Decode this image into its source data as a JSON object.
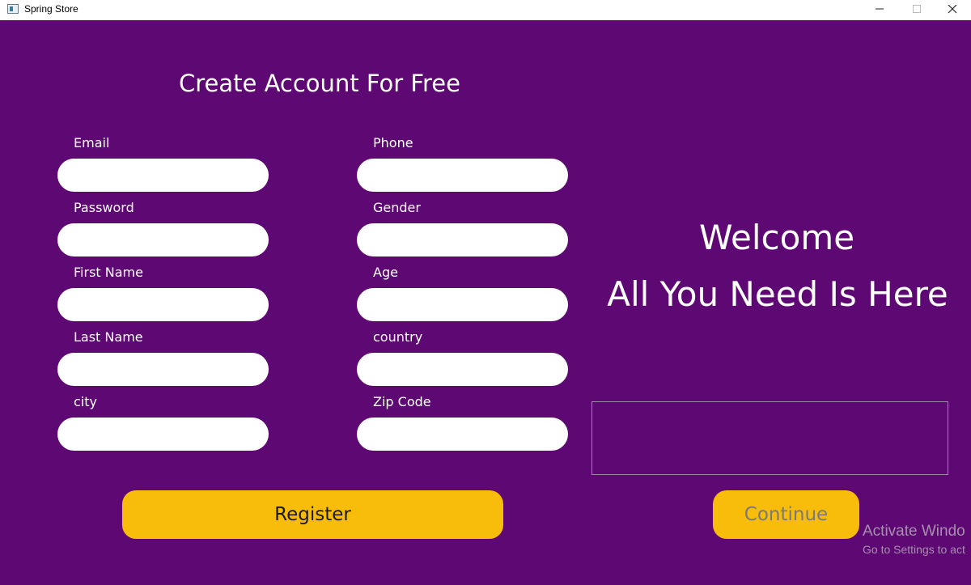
{
  "window": {
    "title": "Spring Store",
    "controls": {
      "minimize": "minimize-icon",
      "maximize": "maximize-icon",
      "close": "close-icon"
    }
  },
  "form": {
    "heading": "Create Account For Free",
    "left_fields": [
      {
        "label": "Email",
        "value": ""
      },
      {
        "label": "Password",
        "value": ""
      },
      {
        "label": "First Name",
        "value": ""
      },
      {
        "label": "Last Name",
        "value": ""
      },
      {
        "label": "city",
        "value": ""
      }
    ],
    "right_fields": [
      {
        "label": "Phone",
        "value": ""
      },
      {
        "label": "Gender",
        "value": ""
      },
      {
        "label": "Age",
        "value": ""
      },
      {
        "label": "country",
        "value": ""
      },
      {
        "label": "Zip Code",
        "value": ""
      }
    ],
    "register_label": "Register"
  },
  "side": {
    "welcome": "Welcome",
    "tagline": "All You Need Is Here",
    "message": "",
    "continue_label": "Continue"
  },
  "watermark": {
    "title": "Activate Windo",
    "subtitle": "Go to Settings to act"
  },
  "colors": {
    "background": "#5e0973",
    "button": "#f8bd0b",
    "input": "#ffffff"
  }
}
